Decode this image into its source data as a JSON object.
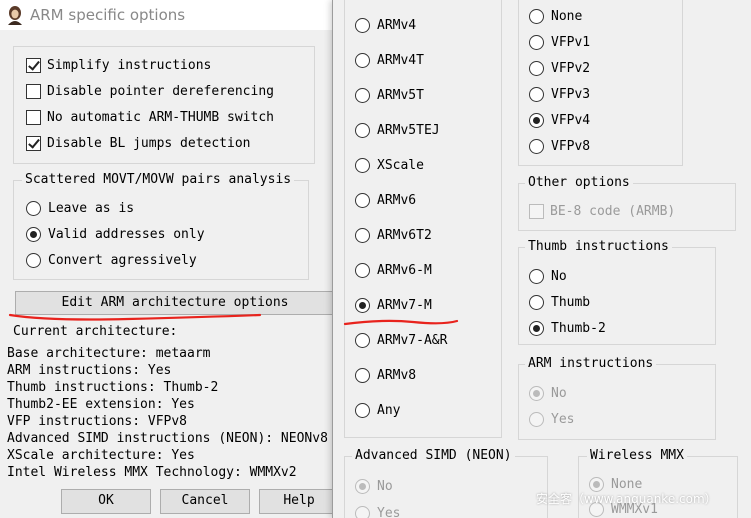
{
  "window": {
    "title": "ARM specific options"
  },
  "checkboxes": [
    {
      "label": "Simplify instructions",
      "checked": true
    },
    {
      "label": "Disable pointer dereferencing",
      "checked": false
    },
    {
      "label": "No automatic ARM-THUMB switch",
      "checked": false
    },
    {
      "label": "Disable BL jumps detection",
      "checked": true
    }
  ],
  "movt_group": {
    "title": "Scattered MOVT/MOVW pairs analysis",
    "options": [
      {
        "label": "Leave as is",
        "selected": false
      },
      {
        "label": "Valid addresses only",
        "selected": true
      },
      {
        "label": "Convert agressively",
        "selected": false
      }
    ]
  },
  "edit_button": {
    "label": "Edit ARM architecture options"
  },
  "current_arch": {
    "heading": "Current architecture:",
    "lines": [
      "Base architecture: metaarm",
      "ARM instructions: Yes",
      "Thumb instructions: Thumb-2",
      "Thumb2-EE extension: Yes",
      "VFP instructions: VFPv8",
      "Advanced SIMD instructions (NEON): NEONv8",
      "XScale architecture: Yes",
      "Intel Wireless MMX Technology: WMMXv2"
    ]
  },
  "buttons": {
    "ok": "OK",
    "cancel": "Cancel",
    "help": "Help"
  },
  "arch_dialog": {
    "base_arch": [
      {
        "label": "ARMv4",
        "selected": false
      },
      {
        "label": "ARMv4T",
        "selected": false
      },
      {
        "label": "ARMv5T",
        "selected": false
      },
      {
        "label": "ARMv5TEJ",
        "selected": false
      },
      {
        "label": "XScale",
        "selected": false
      },
      {
        "label": "ARMv6",
        "selected": false
      },
      {
        "label": "ARMv6T2",
        "selected": false
      },
      {
        "label": "ARMv6-M",
        "selected": false
      },
      {
        "label": "ARMv7-M",
        "selected": true
      },
      {
        "label": "ARMv7-A&R",
        "selected": false
      },
      {
        "label": "ARMv8",
        "selected": false
      },
      {
        "label": "Any",
        "selected": false
      }
    ],
    "vfp": [
      {
        "label": "None",
        "selected": false
      },
      {
        "label": "VFPv1",
        "selected": false
      },
      {
        "label": "VFPv2",
        "selected": false
      },
      {
        "label": "VFPv3",
        "selected": false
      },
      {
        "label": "VFPv4",
        "selected": true
      },
      {
        "label": "VFPv8",
        "selected": false
      }
    ],
    "other_options": {
      "title": "Other options",
      "be8": {
        "label": "BE-8 code (ARMB)",
        "checked": false,
        "disabled": true
      }
    },
    "thumb": {
      "title": "Thumb instructions",
      "options": [
        {
          "label": "No",
          "selected": false
        },
        {
          "label": "Thumb",
          "selected": false
        },
        {
          "label": "Thumb-2",
          "selected": true
        }
      ]
    },
    "arm": {
      "title": "ARM instructions",
      "options": [
        {
          "label": "No",
          "selected": true,
          "disabled": true
        },
        {
          "label": "Yes",
          "selected": false,
          "disabled": true
        }
      ]
    },
    "simd": {
      "title": "Advanced SIMD (NEON)",
      "options": [
        {
          "label": "No",
          "selected": true,
          "disabled": true
        },
        {
          "label": "Yes",
          "selected": false,
          "disabled": true
        }
      ]
    },
    "wmmx": {
      "title": "Wireless MMX",
      "options": [
        {
          "label": "None",
          "selected": true,
          "disabled": true
        },
        {
          "label": "WMMXv1",
          "selected": false,
          "disabled": true
        }
      ]
    }
  },
  "watermark": "安全客（www.anquanke.com）",
  "colors": {
    "annotation_red": "#e8231d",
    "disabled_text": "#9a9a9a"
  }
}
